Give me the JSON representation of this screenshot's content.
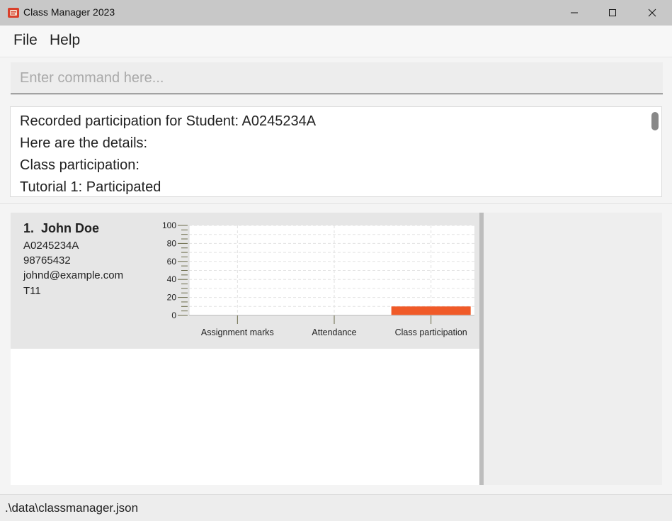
{
  "window": {
    "title": "Class Manager 2023",
    "icon": "app-logo-icon",
    "controls": [
      "minimize-icon",
      "maximize-icon",
      "close-icon"
    ]
  },
  "menu": {
    "file_label": "File",
    "help_label": "Help"
  },
  "command": {
    "value": "",
    "placeholder": "Enter command here..."
  },
  "result": {
    "lines": [
      "Recorded participation for Student: A0245234A",
      "Here are the details:",
      "Class participation:",
      "Tutorial 1: Participated"
    ]
  },
  "students": [
    {
      "index": "1.",
      "name": "John Doe",
      "student_number": "A0245234A",
      "phone": "98765432",
      "email": "johnd@example.com",
      "class_number": "T11",
      "chart_data": {
        "type": "bar",
        "categories": [
          "Assignment marks",
          "Attendance",
          "Class participation"
        ],
        "values": [
          0,
          0,
          10
        ],
        "ylim": [
          0,
          100
        ],
        "yticks": [
          "0",
          "20",
          "40",
          "60",
          "80",
          "100"
        ],
        "grid": true,
        "bar_color": "#f05a28"
      }
    }
  ],
  "status": {
    "file_path": ".\\data\\classmanager.json"
  }
}
